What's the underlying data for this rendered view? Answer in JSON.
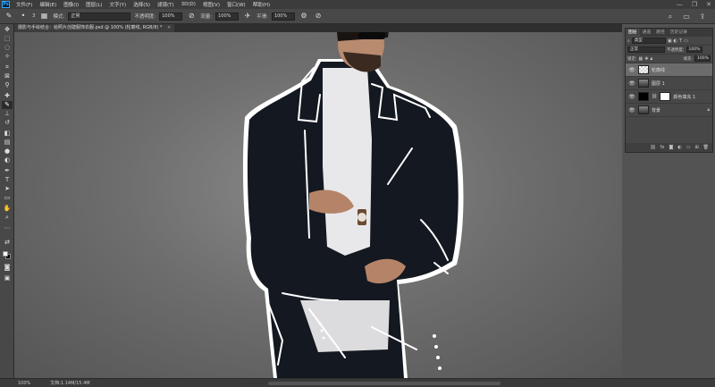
{
  "app": {
    "logo": "Ps"
  },
  "menu": [
    "文件(F)",
    "编辑(E)",
    "图像(I)",
    "图层(L)",
    "文字(Y)",
    "选择(S)",
    "滤镜(T)",
    "3D(D)",
    "视图(V)",
    "窗口(W)",
    "帮助(H)"
  ],
  "window_controls": {
    "minimize": "—",
    "maximize": "❐",
    "close": "✕"
  },
  "options": {
    "size": "3",
    "mode_label": "模式:",
    "mode_value": "正常",
    "opacity_label": "不透明度:",
    "opacity_value": "100%",
    "flow_label": "流量:",
    "flow_value": "100%",
    "smoothing_label": "平滑:",
    "smoothing_value": "100%"
  },
  "document_tab": {
    "title": "摄影与手绘结合：给照片创建服饰衣服.psd @ 100% (轮廓线, RGB/8) *",
    "close": "×"
  },
  "layers_panel": {
    "tabs": [
      "图层",
      "通道",
      "路径",
      "历史记录"
    ],
    "filter_label": "类型",
    "blend_mode": "正常",
    "opacity_label": "不透明度:",
    "opacity_value": "100%",
    "lock_label": "锁定:",
    "fill_label": "填充:",
    "fill_value": "100%",
    "layers": [
      {
        "name": "轮廓线",
        "thumb": "checker",
        "selected": true
      },
      {
        "name": "图层 1",
        "thumb": "person",
        "selected": false
      },
      {
        "name": "颜色填充 1",
        "thumb": "black",
        "selected": false,
        "mask": true
      },
      {
        "name": "背景",
        "thumb": "person",
        "selected": false,
        "locked": true
      }
    ]
  },
  "status": {
    "zoom": "100%",
    "doc_info": "文档:1.14M/15.4M"
  },
  "colors": {
    "foreground": "#ffffff",
    "background": "#000000",
    "accent": "#31a8ff"
  }
}
